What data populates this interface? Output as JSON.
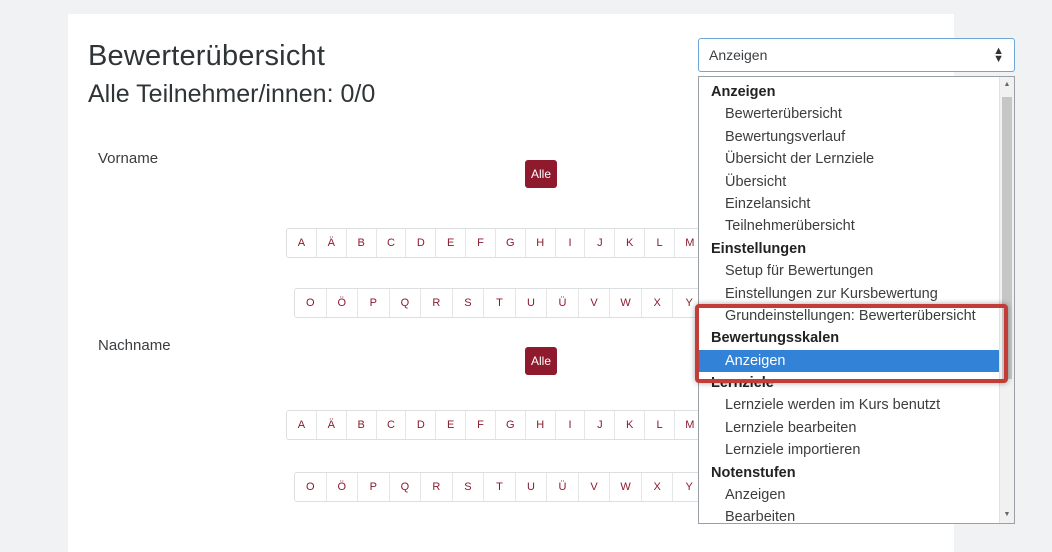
{
  "page": {
    "title": "Bewerterübersicht",
    "subtitle": "Alle Teilnehmer/innen: 0/0"
  },
  "filters": {
    "firstname_label": "Vorname",
    "lastname_label": "Nachname",
    "all_label": "Alle",
    "letters_row1": [
      "A",
      "Ä",
      "B",
      "C",
      "D",
      "E",
      "F",
      "G",
      "H",
      "I",
      "J",
      "K",
      "L",
      "M"
    ],
    "letters_row2": [
      "O",
      "Ö",
      "P",
      "Q",
      "R",
      "S",
      "T",
      "U",
      "Ü",
      "V",
      "W",
      "X",
      "Y"
    ]
  },
  "select": {
    "value": "Anzeigen",
    "arrows_icon": "up-down-arrows-icon"
  },
  "dropdown": {
    "rows": [
      {
        "label": "Anzeigen",
        "type": "group"
      },
      {
        "label": "Bewerterübersicht",
        "type": "item"
      },
      {
        "label": "Bewertungsverlauf",
        "type": "item"
      },
      {
        "label": "Übersicht der Lernziele",
        "type": "item"
      },
      {
        "label": "Übersicht",
        "type": "item"
      },
      {
        "label": "Einzelansicht",
        "type": "item"
      },
      {
        "label": "Teilnehmerübersicht",
        "type": "item"
      },
      {
        "label": "Einstellungen",
        "type": "group"
      },
      {
        "label": "Setup für Bewertungen",
        "type": "item"
      },
      {
        "label": "Einstellungen zur Kursbewertung",
        "type": "item"
      },
      {
        "label": "Grundeinstellungen: Bewerterübersicht",
        "type": "item"
      },
      {
        "label": "Bewertungsskalen",
        "type": "group"
      },
      {
        "label": "Anzeigen",
        "type": "item",
        "selected": true
      },
      {
        "label": "Lernziele",
        "type": "group"
      },
      {
        "label": "Lernziele werden im Kurs benutzt",
        "type": "item"
      },
      {
        "label": "Lernziele bearbeiten",
        "type": "item"
      },
      {
        "label": "Lernziele importieren",
        "type": "item"
      },
      {
        "label": "Notenstufen",
        "type": "group"
      },
      {
        "label": "Anzeigen",
        "type": "item"
      },
      {
        "label": "Bearbeiten",
        "type": "item"
      }
    ]
  },
  "colors": {
    "brand_button": "#8f1a2d",
    "selected_option": "#3282d8",
    "annotation_border": "#c23c38"
  }
}
